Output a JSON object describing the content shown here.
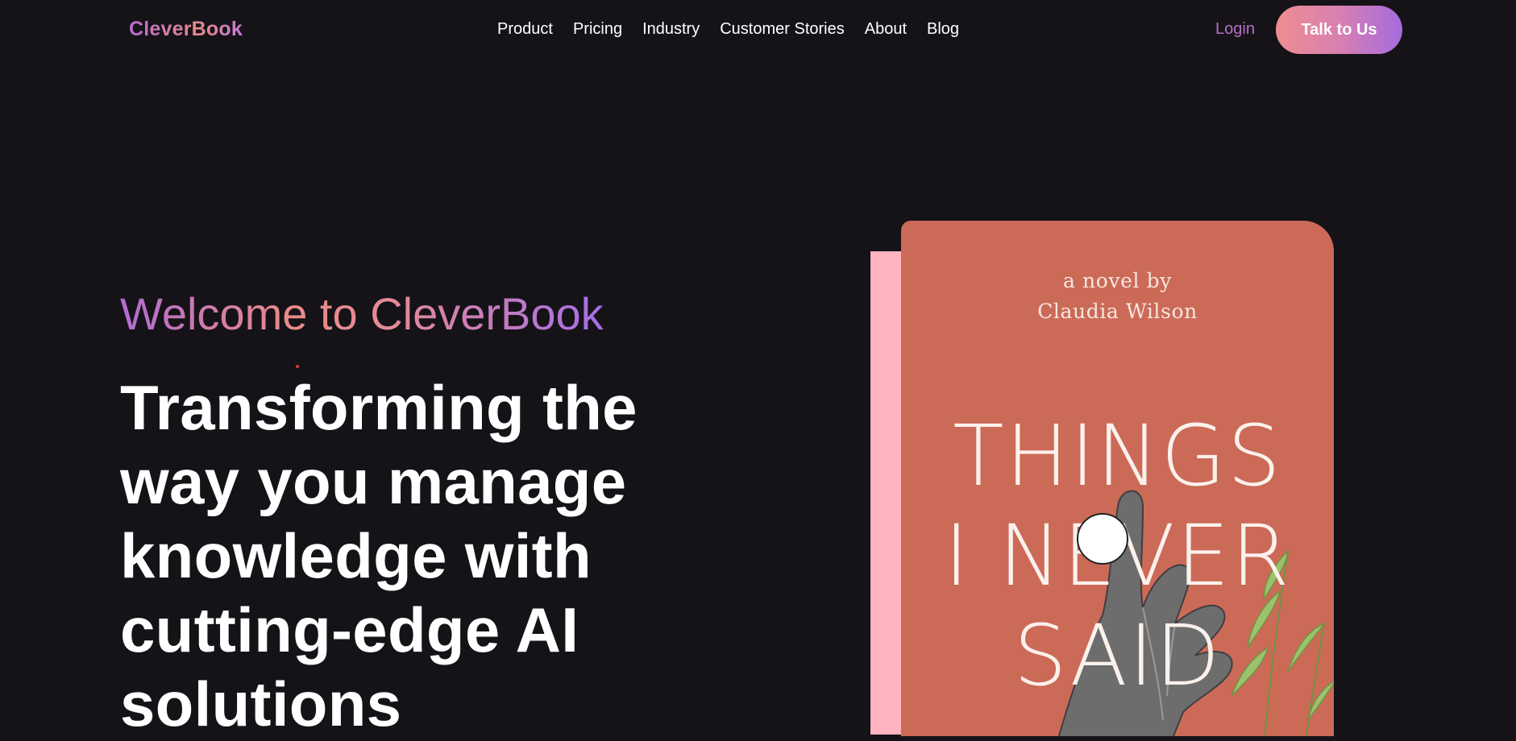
{
  "brand": {
    "name": "CleverBook"
  },
  "nav": {
    "links": [
      {
        "label": "Product"
      },
      {
        "label": "Pricing"
      },
      {
        "label": "Industry"
      },
      {
        "label": "Customer Stories"
      },
      {
        "label": "About"
      },
      {
        "label": "Blog"
      }
    ],
    "login_label": "Login",
    "cta_label": "Talk to Us"
  },
  "hero": {
    "welcome": "Welcome to CleverBook",
    "headline": "Transforming the way you manage knowledge with cutting-edge AI solutions"
  },
  "book": {
    "byline_1": "a novel by",
    "byline_2": "Claudia Wilson",
    "title_1": "THINGS",
    "title_2": "I NEVER",
    "title_3": "SAID",
    "cover_color": "#cc6a58",
    "spine_color": "#ffb4bf"
  },
  "colors": {
    "background": "#151318",
    "accent_pink": "#ef8d92",
    "accent_purple": "#a56be0",
    "login": "#b66fc8"
  }
}
